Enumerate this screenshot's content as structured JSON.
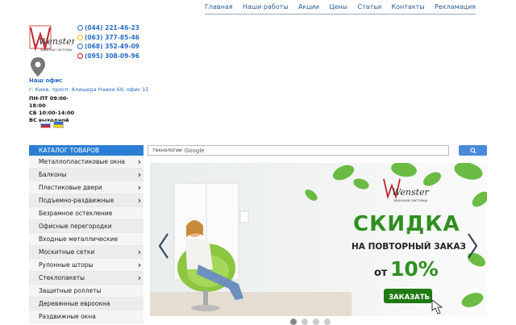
{
  "nav": {
    "items": [
      "Главная",
      "Наши работы",
      "Акции",
      "Цены",
      "Статьи",
      "Контакты",
      "Рекламация"
    ]
  },
  "logo": {
    "text": "Wenster",
    "sub": "оконные системы"
  },
  "phones": [
    {
      "number": "(044) 221-46-23",
      "color": "#2b6cc4"
    },
    {
      "number": "(063) 377-85-46",
      "color": "#f5c200"
    },
    {
      "number": "(068) 352-49-09",
      "color": "#2b6cc4"
    },
    {
      "number": "(095) 308-09-96",
      "color": "#e30613"
    }
  ],
  "office": {
    "title": "Наш офис",
    "address": "г. Киев, просп. Алишера Навои 69, офис 15",
    "hours": [
      "ПН-ПТ 09:00-18:00",
      "СБ 10:00-14:00",
      "ВС выходной"
    ]
  },
  "catalog": {
    "title": "КАТАЛОГ ТОВАРОВ",
    "items": [
      {
        "label": "Металлопластиковые окна",
        "arrow": true
      },
      {
        "label": "Балконы",
        "arrow": true
      },
      {
        "label": "Пластиковые двери",
        "arrow": true
      },
      {
        "label": "Подъемно-раздвижные",
        "arrow": true
      },
      {
        "label": "Безрамное остекление",
        "arrow": false
      },
      {
        "label": "Офисные перегородки",
        "arrow": false
      },
      {
        "label": "Входные металлические",
        "arrow": false
      },
      {
        "label": "Москитные сетки",
        "arrow": true
      },
      {
        "label": "Рулонные шторы",
        "arrow": true
      },
      {
        "label": "Стеклопакеты",
        "arrow": true
      },
      {
        "label": "Защитные роллеты",
        "arrow": false
      },
      {
        "label": "Деревянные евроокна",
        "arrow": false
      },
      {
        "label": "Раздвижные окна",
        "arrow": false
      }
    ]
  },
  "search": {
    "prefix": "технологии",
    "brand": "Google"
  },
  "banner": {
    "brand": "Wenster",
    "brand_sub": "оконные системы",
    "headline": "СКИДКА",
    "line2": "НА ПОВТОРНЫЙ ЗАКАЗ",
    "line3_prefix": "от",
    "percent": "10%",
    "cta": "ЗАКАЗАТЬ"
  },
  "colors": {
    "accent": "#2a7fd4",
    "green": "#2f8f1f",
    "link": "#2b5c8f"
  }
}
